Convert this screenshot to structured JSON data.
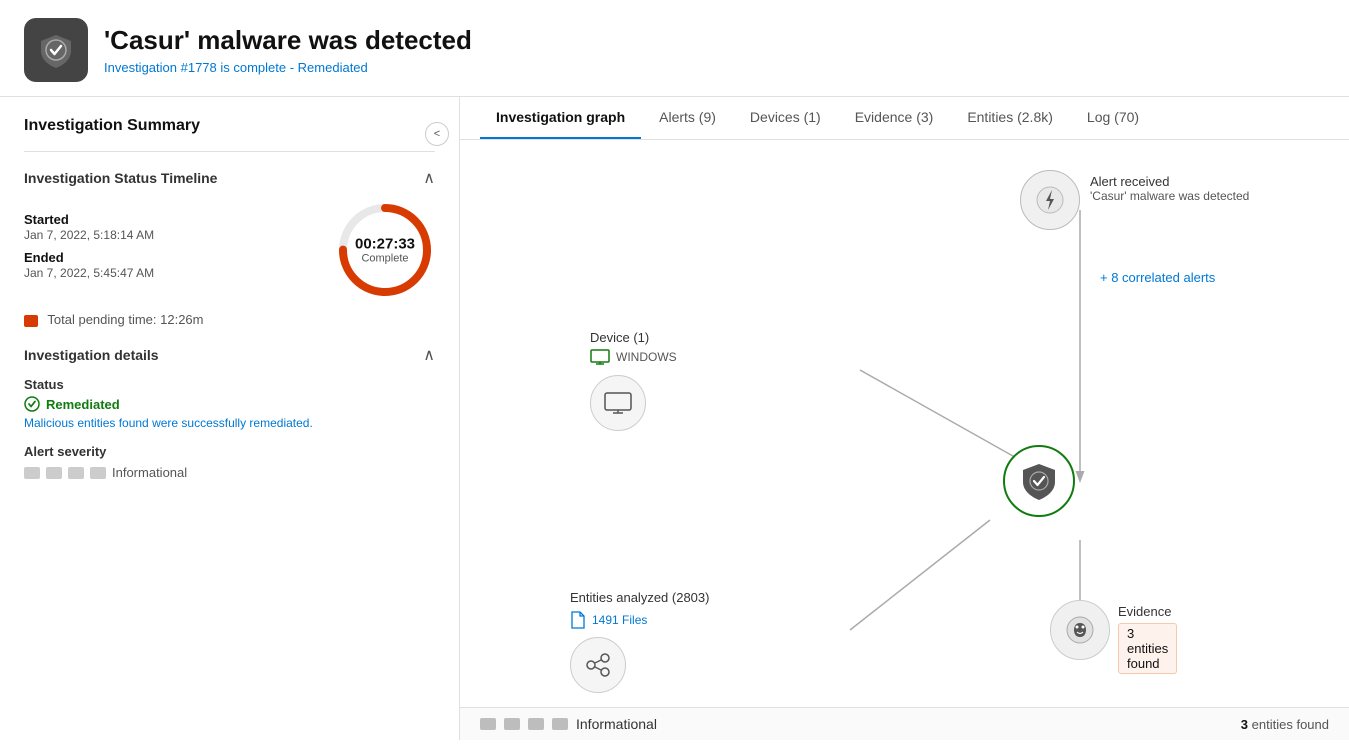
{
  "header": {
    "title": "'Casur' malware was detected",
    "subtitle": "Investigation #1778 is complete - Remediated",
    "icon_label": "shield-check-icon"
  },
  "sidebar": {
    "title": "Investigation Summary",
    "collapse_label": "<",
    "timeline_section": {
      "title": "Investigation Status Timeline",
      "started_label": "Started",
      "started_value": "Jan 7, 2022, 5:18:14 AM",
      "ended_label": "Ended",
      "ended_value": "Jan 7, 2022, 5:45:47 AM",
      "duration": "00:27:33",
      "duration_status": "Complete",
      "pending_label": "Total pending time: 12:26m"
    },
    "details_section": {
      "title": "Investigation details",
      "status_label": "Status",
      "status_value": "Remediated",
      "status_desc": "Malicious entities found were successfully remediated.",
      "alert_severity_label": "Alert severity",
      "alert_severity_value": "Informational"
    }
  },
  "tabs": [
    {
      "id": "investigation-graph",
      "label": "Investigation graph",
      "active": true
    },
    {
      "id": "alerts",
      "label": "Alerts (9)",
      "active": false
    },
    {
      "id": "devices",
      "label": "Devices (1)",
      "active": false
    },
    {
      "id": "evidence",
      "label": "Evidence (3)",
      "active": false
    },
    {
      "id": "entities",
      "label": "Entities (2.8k)",
      "active": false
    },
    {
      "id": "log",
      "label": "Log (70)",
      "active": false
    }
  ],
  "graph": {
    "alert_node": {
      "label": "Alert received",
      "sublabel": "'Casur' malware was detected"
    },
    "correlated_alerts": "+ 8 correlated alerts",
    "device_node": {
      "label": "Device (1)",
      "sublabel": "WINDOWS"
    },
    "center_node_label": "investigation-center",
    "entities_node": {
      "label": "Entities analyzed (2803)",
      "sublabel": "1491 Files"
    },
    "evidence_node": {
      "label": "Evidence",
      "sublabel": "3 entities found"
    }
  },
  "bottom_bar": {
    "severity_label": "Informational",
    "entities_label": "entities found",
    "entities_count": "3"
  }
}
